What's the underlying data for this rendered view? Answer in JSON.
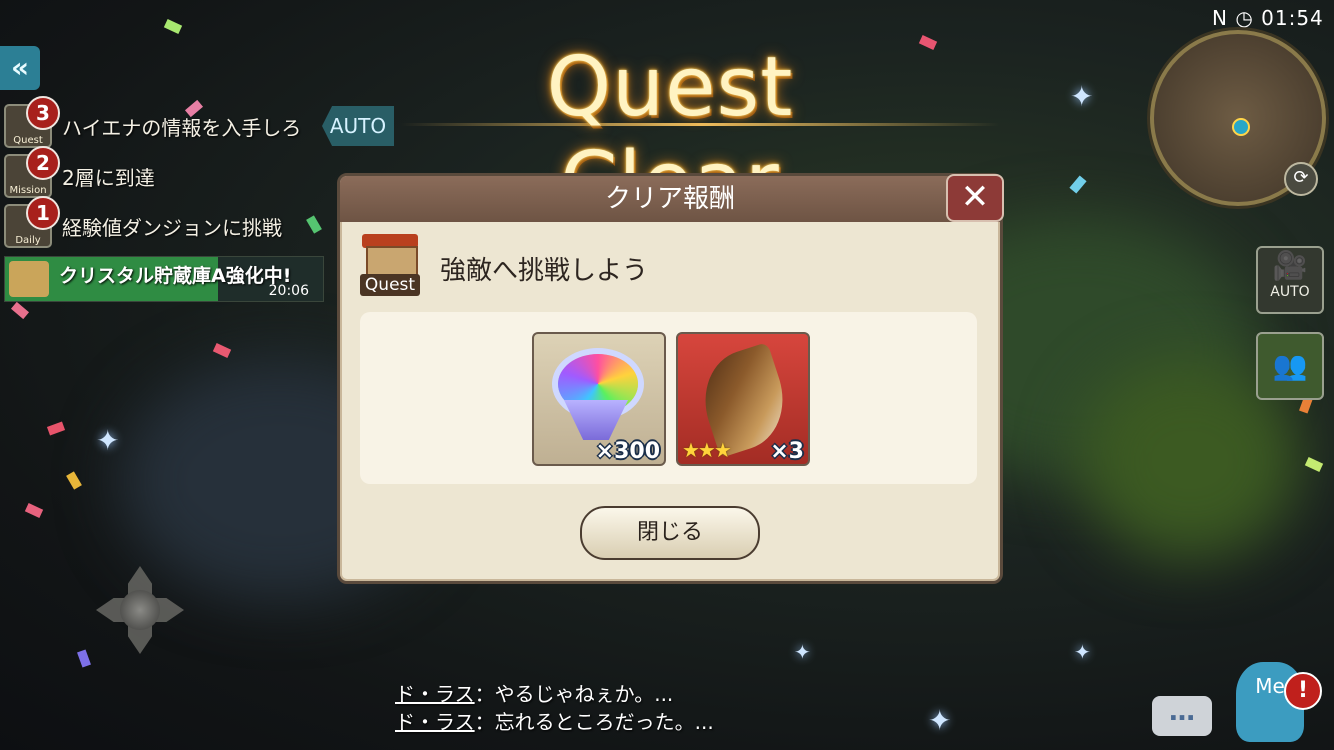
{
  "header": {
    "title": "Quest Clear",
    "clock": "01:54",
    "back_icon": "double-chevron-left-icon"
  },
  "quests": [
    {
      "badge": "3",
      "icon_label": "Quest",
      "text": "ハイエナの情報を入手しろ"
    },
    {
      "badge": "2",
      "icon_label": "Mission",
      "text": "2層に到達"
    },
    {
      "badge": "1",
      "icon_label": "Daily",
      "text": "経験値ダンジョンに挑戦"
    }
  ],
  "auto_tag": "AUTO",
  "crystal": {
    "text": "クリスタル貯蔵庫A強化中!",
    "time": "20:06",
    "progress": 0.67
  },
  "dialog": {
    "title": "クリア報酬",
    "close_symbol": "✕",
    "quest_label": "Quest",
    "subtitle": "強敵へ挑戦しよう",
    "rewards": [
      {
        "name": "rainbow-crystal",
        "quantity": "×300",
        "stars": ""
      },
      {
        "name": "beast-tail",
        "quantity": "×3",
        "stars": "★★★"
      }
    ],
    "close_button": "閉じる"
  },
  "side_buttons": {
    "auto_label": "AUTO",
    "auto_icon": "camera-icon",
    "party_icon": "party-icon"
  },
  "minimap": {
    "compass": "N"
  },
  "chat": [
    {
      "speaker": "ド・ラス",
      "text": "：やるじゃねぇか。..."
    },
    {
      "speaker": "ド・ラス",
      "text": "：忘れるところだった。..."
    }
  ],
  "chat_button": "…",
  "menu": {
    "label": "Me",
    "alert": "!"
  }
}
